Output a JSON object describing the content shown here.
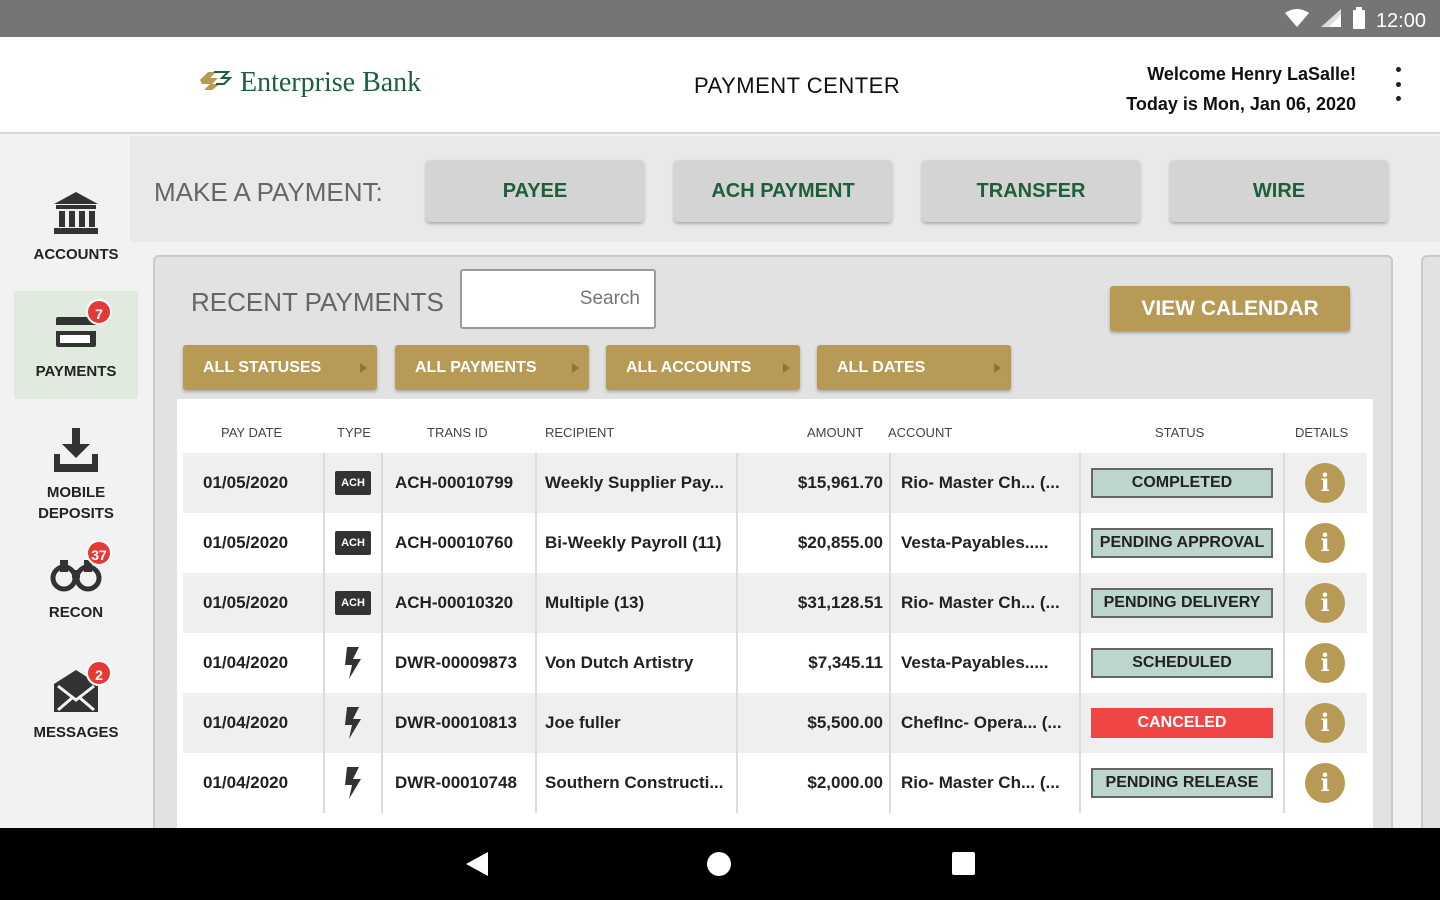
{
  "status_bar": {
    "time": "12:00"
  },
  "header": {
    "logo_text": "Enterprise Bank",
    "page_title": "PAYMENT CENTER",
    "welcome_line": "Welcome Henry LaSalle!",
    "date_line": "Today is Mon, Jan 06, 2020"
  },
  "sidebar": {
    "items": [
      {
        "label": "ACCOUNTS",
        "icon": "bank-icon"
      },
      {
        "label": "PAYMENTS",
        "icon": "card-icon",
        "badge": "7",
        "active": true
      },
      {
        "label1": "MOBILE",
        "label2": "DEPOSITS",
        "icon": "download-tray-icon"
      },
      {
        "label": "RECON",
        "icon": "binoculars-icon",
        "badge": "37"
      },
      {
        "label": "MESSAGES",
        "icon": "envelope-icon",
        "badge": "2"
      }
    ]
  },
  "make_payment": {
    "label": "MAKE A PAYMENT:",
    "buttons": [
      "PAYEE",
      "ACH PAYMENT",
      "TRANSFER",
      "WIRE"
    ]
  },
  "recent": {
    "title": "RECENT PAYMENTS",
    "search_placeholder": "Search",
    "calendar_button": "VIEW CALENDAR",
    "filters": [
      "ALL STATUSES",
      "ALL PAYMENTS",
      "ALL ACCOUNTS",
      "ALL DATES"
    ]
  },
  "table": {
    "columns": [
      "PAY DATE",
      "TYPE",
      "TRANS ID",
      "RECIPIENT",
      "AMOUNT",
      "ACCOUNT",
      "STATUS",
      "DETAILS"
    ],
    "rows": [
      {
        "date": "01/05/2020",
        "type": "ACH",
        "trans_id": "ACH-00010799",
        "recipient": "Weekly Supplier Pay...",
        "amount": "$15,961.70",
        "account": "Rio- Master Ch...  (...",
        "status": "COMPLETED",
        "status_color": "#bcd6cc"
      },
      {
        "date": "01/05/2020",
        "type": "ACH",
        "trans_id": "ACH-00010760",
        "recipient": "Bi-Weekly Payroll (11)",
        "amount": "$20,855.00",
        "account": "Vesta-Payables.....",
        "status": "PENDING APPROVAL",
        "status_color": "#bcd6cc"
      },
      {
        "date": "01/05/2020",
        "type": "ACH",
        "trans_id": "ACH-00010320",
        "recipient": "Multiple (13)",
        "amount": "$31,128.51",
        "account": "Rio- Master Ch...  (...",
        "status": "PENDING DELIVERY",
        "status_color": "#bcd6cc"
      },
      {
        "date": "01/04/2020",
        "type": "WIRE",
        "trans_id": "DWR-00009873",
        "recipient": "Von Dutch Artistry",
        "amount": "$7,345.11",
        "account": "Vesta-Payables.....",
        "status": "SCHEDULED",
        "status_color": "#bcd6cc"
      },
      {
        "date": "01/04/2020",
        "type": "WIRE",
        "trans_id": "DWR-00010813",
        "recipient": "Joe fuller",
        "amount": "$5,500.00",
        "account": "ChefInc- Opera...  (...",
        "status": "CANCELED",
        "status_color": "#f04545"
      },
      {
        "date": "01/04/2020",
        "type": "WIRE",
        "trans_id": "DWR-00010748",
        "recipient": "Southern Constructi...",
        "amount": "$2,000.00",
        "account": "Rio- Master Ch...  (...",
        "status": "PENDING RELEASE",
        "status_color": "#bcd6cc"
      }
    ],
    "info_icon_glyph": "i",
    "ach_badge_text": "ACH"
  },
  "colors": {
    "brand_green": "#1e5e3a",
    "brand_gold": "#b79a55",
    "status_green": "#bcd6cc",
    "status_red": "#f04545",
    "badge_red": "#e53935"
  }
}
